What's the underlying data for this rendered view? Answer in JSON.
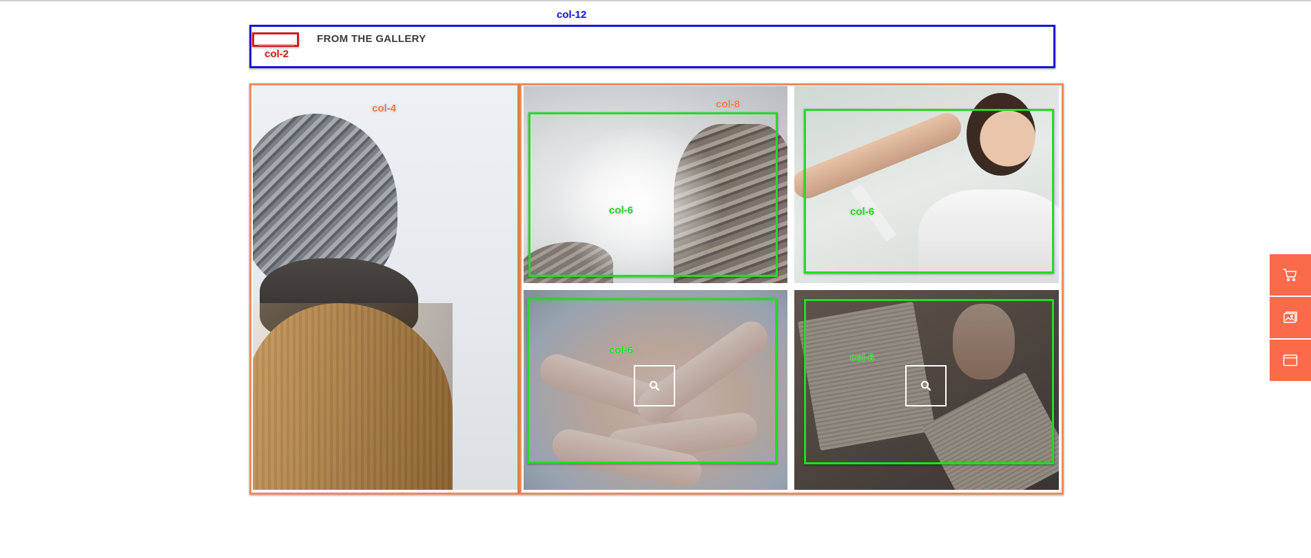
{
  "heading": "FROM THE GALLERY",
  "grid_labels": {
    "col12": "col-12",
    "col2": "col-2",
    "col4": "col-4",
    "col8": "col-8",
    "col6": "col-6"
  },
  "gallery": {
    "items": [
      {
        "name": "hooded-person-photo"
      },
      {
        "name": "foggy-mountain-photo"
      },
      {
        "name": "joyful-woman-photo"
      },
      {
        "name": "stacked-hands-photo"
      },
      {
        "name": "open-books-photo"
      }
    ]
  },
  "colors": {
    "col12_outline": "#1818d0",
    "col2_outline": "#d41a1a",
    "col4_col8_outline": "#ee8a5c",
    "col6_outline": "#22dd22",
    "side_action_bg": "#fb6a4a"
  },
  "side_actions": [
    {
      "icon": "cart-icon"
    },
    {
      "icon": "gallery-icon"
    },
    {
      "icon": "browser-window-icon"
    }
  ]
}
